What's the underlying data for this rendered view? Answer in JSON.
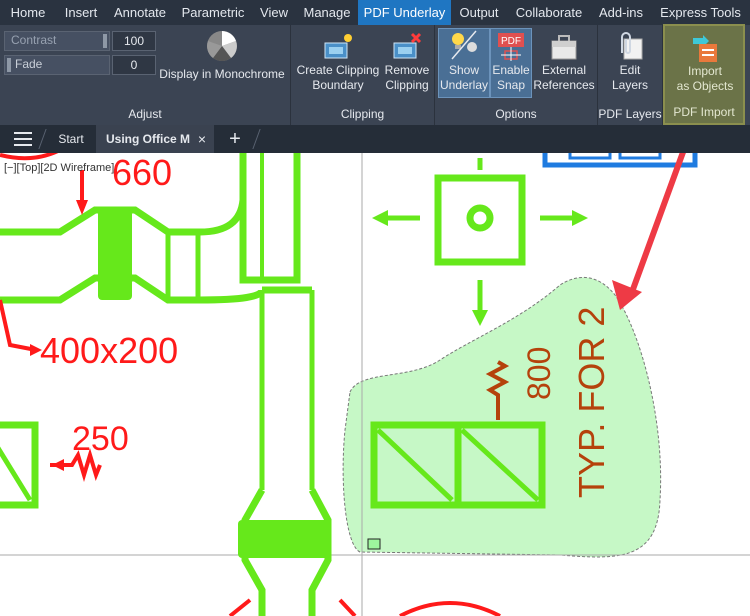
{
  "menu": {
    "home": "Home",
    "insert": "Insert",
    "annotate": "Annotate",
    "parametric": "Parametric",
    "view": "View",
    "manage": "Manage",
    "pdf_underlay": "PDF Underlay",
    "output": "Output",
    "collaborate": "Collaborate",
    "add_ins": "Add-ins",
    "express_tools": "Express Tools"
  },
  "adjust": {
    "contrast_label": "Contrast",
    "contrast_value": "100",
    "fade_label": "Fade",
    "fade_value": "0",
    "monochrome_line1": "Display in Monochrome",
    "panel_label": "Adjust"
  },
  "clipping": {
    "create_line1": "Create Clipping",
    "create_line2": "Boundary",
    "remove_line1": "Remove",
    "remove_line2": "Clipping",
    "panel_label": "Clipping"
  },
  "options": {
    "show_line1": "Show",
    "show_line2": "Underlay",
    "snap_line1": "Enable",
    "snap_line2": "Snap",
    "snap_icon_text": "PDF",
    "external_line1": "External",
    "external_line2": "References",
    "panel_label": "Options"
  },
  "pdf_layers": {
    "edit_line1": "Edit",
    "edit_line2": "Layers",
    "panel_label": "PDF Layers"
  },
  "pdf_import": {
    "import_line1": "Import",
    "import_line2": "as Objects",
    "panel_label": "PDF Import"
  },
  "tabs": {
    "start": "Start",
    "drawing": "Using Office M"
  },
  "viewport": {
    "label": "[−][Top][2D Wireframe]"
  },
  "drawing": {
    "dim_660": "660",
    "dim_400x200": "400x200",
    "dim_250": "250",
    "dim_800": "800",
    "note": "TYP. FOR 2"
  },
  "colors": {
    "ribbon_bg": "#3b4453",
    "menu_active": "#1f76c2",
    "duct_green": "#66e81b",
    "annotation_red": "#ff1a1a",
    "note_brown": "#b5420b",
    "callout_arrow": "#ee3a45",
    "highlight_fill": "#c6f8c6"
  }
}
